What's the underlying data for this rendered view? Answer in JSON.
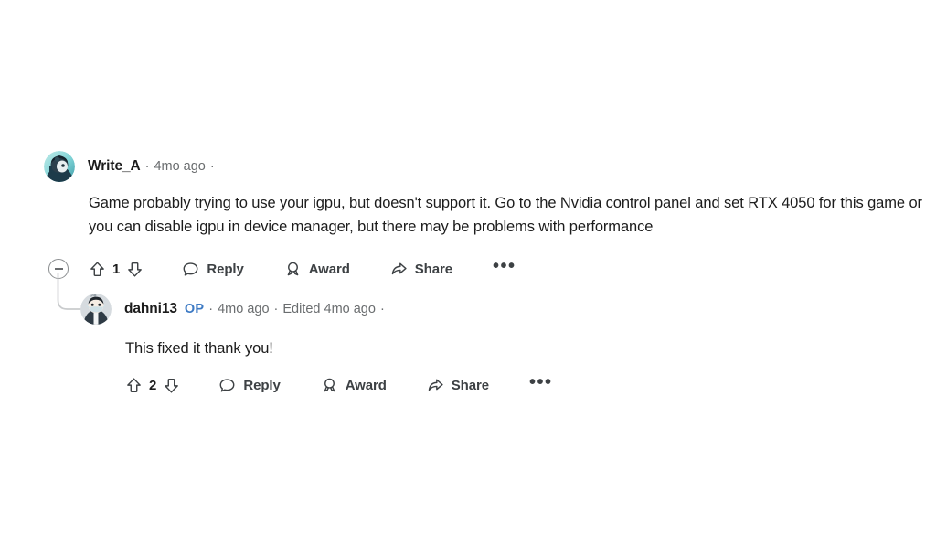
{
  "colors": {
    "text": "#1c1c1c",
    "meta": "#6a6d6f",
    "action": "#3d4144",
    "op_blue": "#3d7ac4",
    "thread_line": "#c9cbcd",
    "background": "#ffffff"
  },
  "comment": {
    "author": "Write_A",
    "dot1": "·",
    "timestamp": "4mo ago",
    "dot2": "·",
    "body": "Game probably trying to use your igpu, but doesn't support it. Go to the Nvidia control panel and set RTX 4050 for this game or you can disable igpu in device manager, but there may be problems with performance",
    "actions": {
      "collapse": "collapse-thread",
      "upvote": "upvote",
      "vote_count": "1",
      "downvote": "downvote",
      "reply_label": "Reply",
      "award_label": "Award",
      "share_label": "Share",
      "overflow": "•••"
    }
  },
  "reply": {
    "author": "dahni13",
    "op_label": "OP",
    "dot1": "·",
    "timestamp": "4mo ago",
    "dot2": "·",
    "edited": "Edited 4mo ago",
    "dot3": "·",
    "body": "This fixed it thank you!",
    "actions": {
      "upvote": "upvote",
      "vote_count": "2",
      "downvote": "downvote",
      "reply_label": "Reply",
      "award_label": "Award",
      "share_label": "Share",
      "overflow": "•••"
    }
  }
}
